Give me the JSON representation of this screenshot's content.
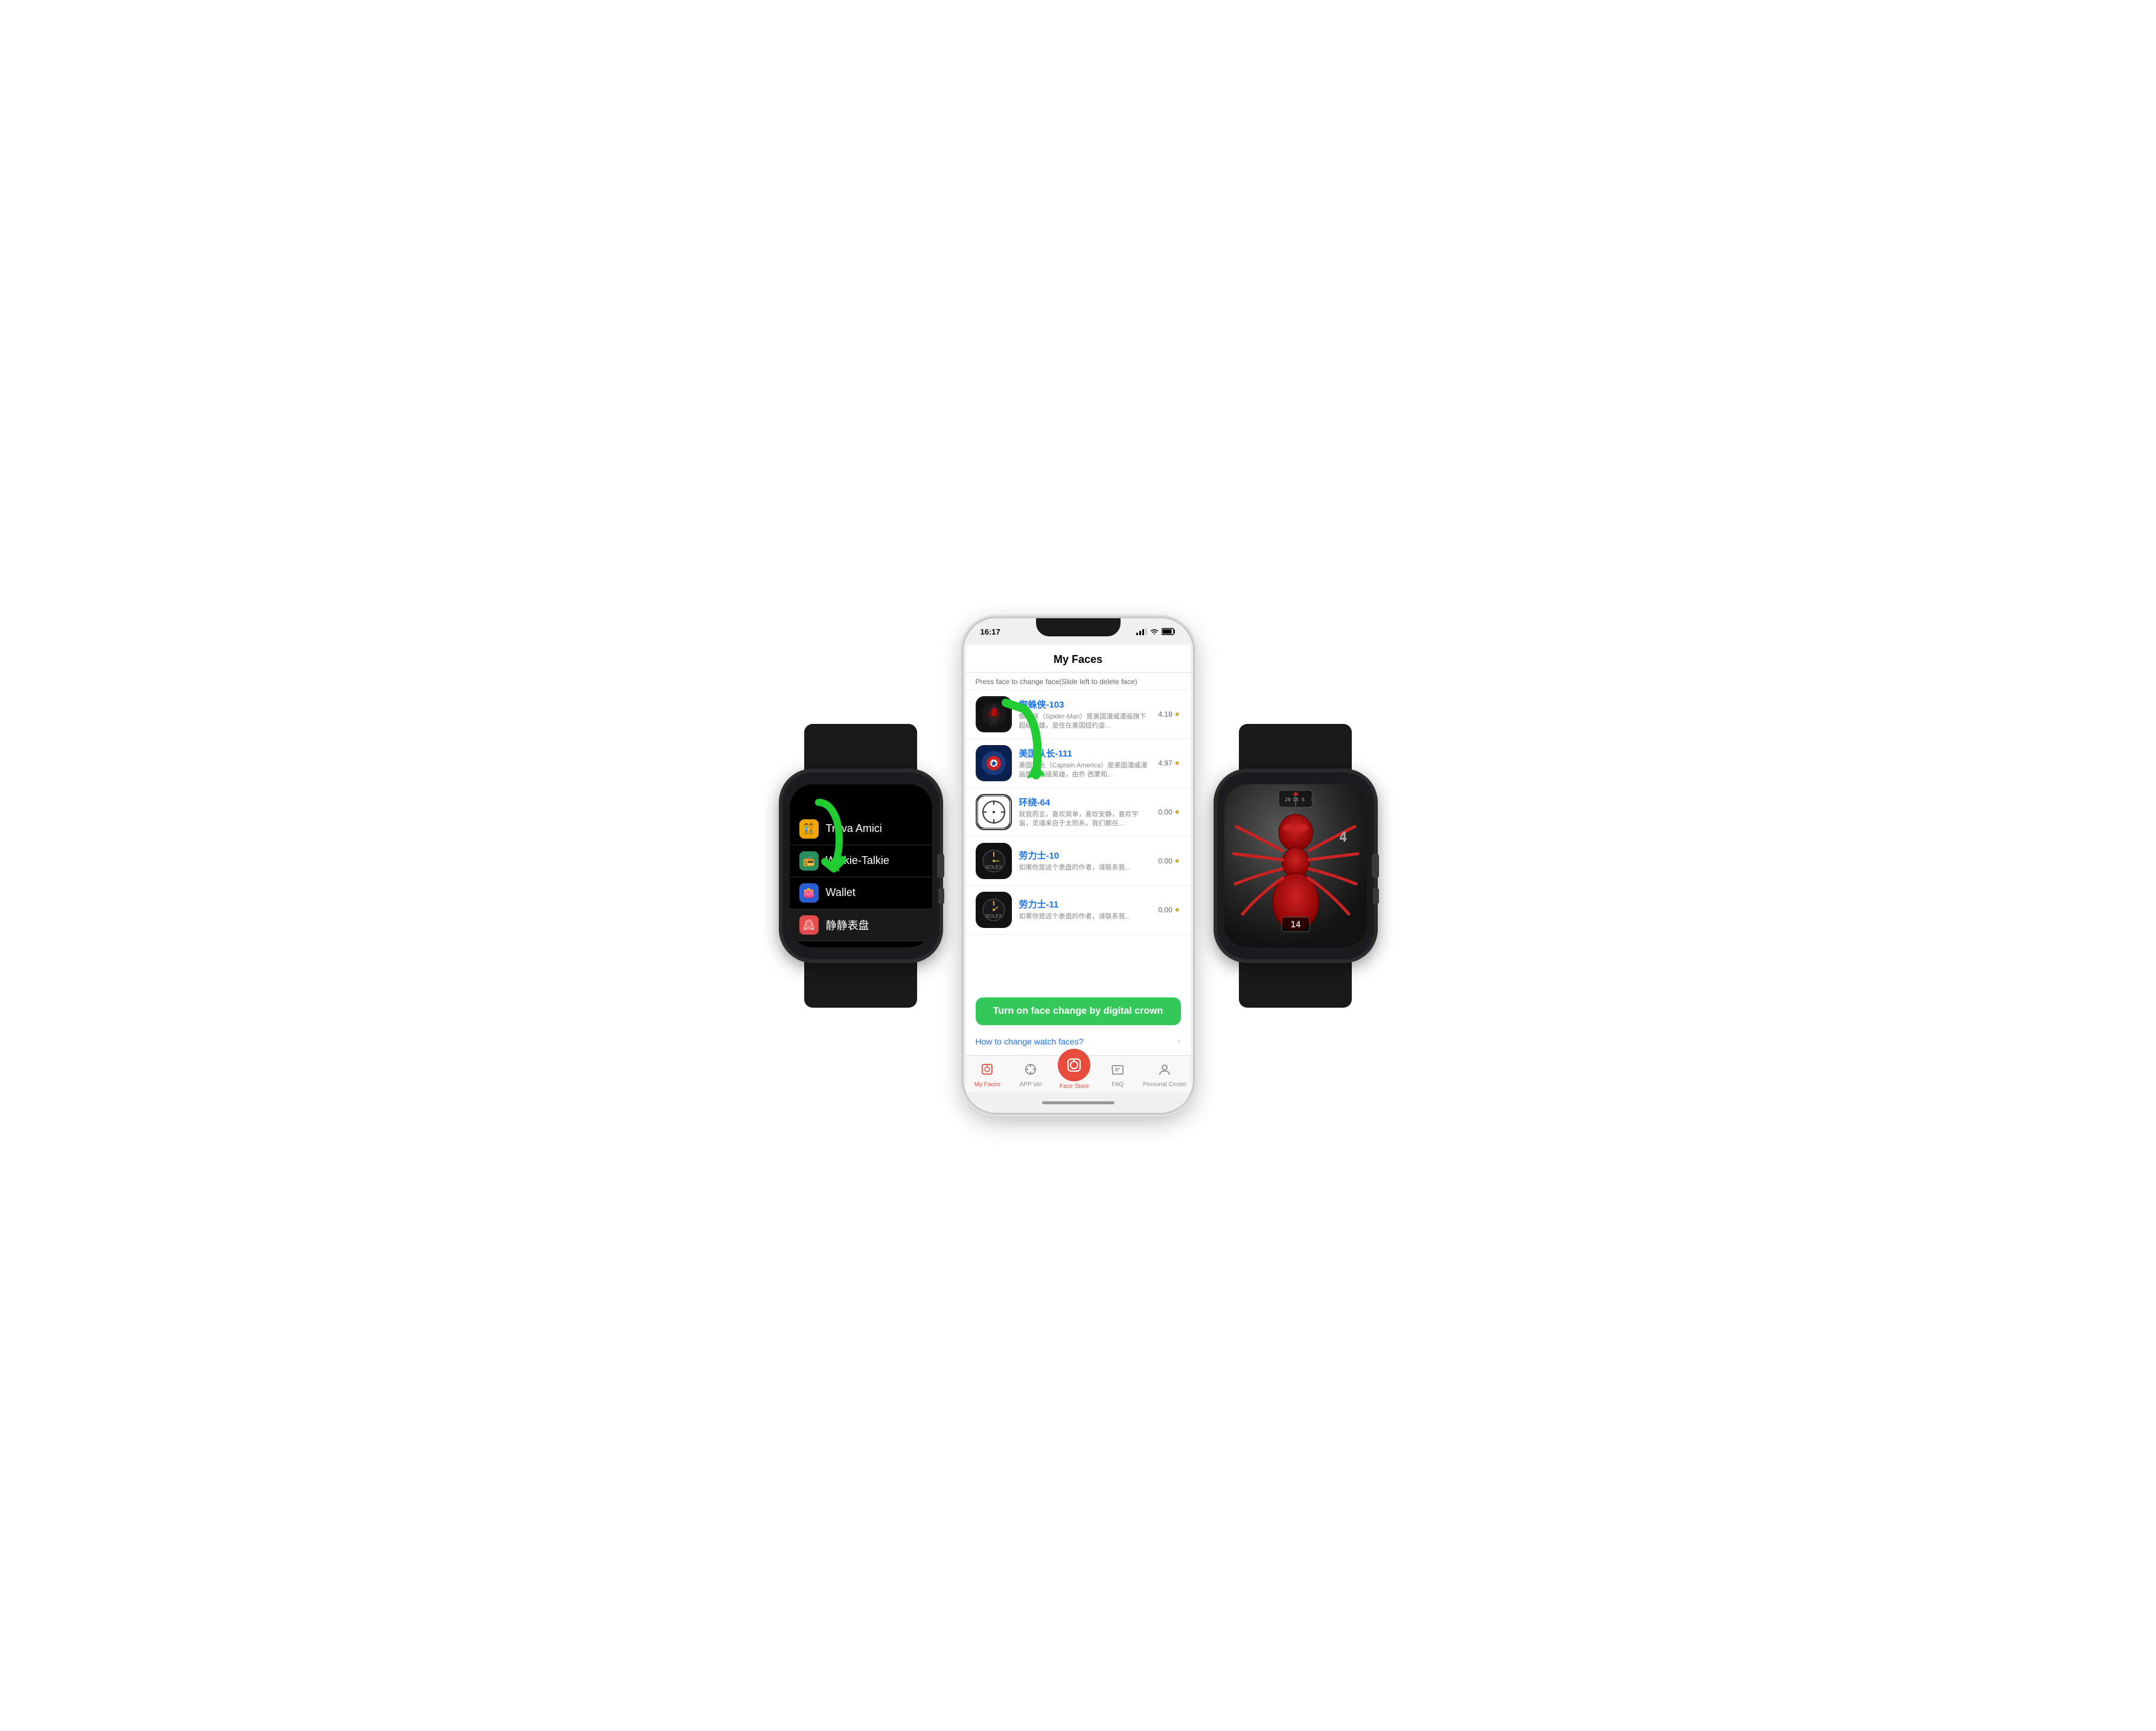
{
  "scene": {
    "bg_color": "#ffffff"
  },
  "watch_left": {
    "menu_items": [
      {
        "id": "trova",
        "icon": "🧑‍🤝‍🧑",
        "icon_bg": "#f0a500",
        "label": "Trova Amici"
      },
      {
        "id": "walkie",
        "icon": "",
        "icon_bg": "transparent",
        "label": "Walkie-Talkie"
      },
      {
        "id": "wallet",
        "icon": "",
        "icon_bg": "transparent",
        "label": "Wallet"
      },
      {
        "id": "jingji",
        "icon": "🕰",
        "icon_bg": "#e74c4c",
        "label": "静静表盘"
      }
    ]
  },
  "iphone": {
    "status_bar": {
      "time": "16:17",
      "signal": "▲▲▲",
      "wifi": "wifi",
      "battery": "battery"
    },
    "screen": {
      "title": "My Faces",
      "subtitle": "Press face to change face(Slide left to delete face)",
      "faces": [
        {
          "id": "spiderman",
          "title": "蜘蛛侠-103",
          "desc": "蜘蛛侠（Spider-Man）是美国漫威漫画旗下超级英雄，是住在美国纽约皇...",
          "rating": "4.18"
        },
        {
          "id": "captain",
          "title": "美国队长-111",
          "desc": "美国队长（Captain America）是美国漫威漫画旗下超级英雄，由乔·西蒙和...",
          "rating": "4.97"
        },
        {
          "id": "huanrao",
          "title": "环绕-64",
          "desc": "就我而言，喜欢简单，喜欢安静，喜欢宇宙，灵魂来自于太阳系，我们都在...",
          "rating": "0.00"
        },
        {
          "id": "rolex10",
          "title": "劳力士-10",
          "desc": "如果你是这个表盘的作者，请联系我...",
          "rating": "0.00"
        },
        {
          "id": "rolex11",
          "title": "劳力士-11",
          "desc": "如果你是这个表盘的作者，请联系我...",
          "rating": "0.00"
        }
      ],
      "green_btn": "Turn on face change by digital crown",
      "how_to_link": "How to change watch faces?",
      "tab_bar": {
        "tabs": [
          {
            "id": "myfaces",
            "icon": "🕐",
            "label": "My Faces",
            "active": true
          },
          {
            "id": "appver",
            "icon": "📡",
            "label": "APP Ver",
            "active": false
          },
          {
            "id": "facestore",
            "icon": "🟥",
            "label": "Face Store",
            "center": true
          },
          {
            "id": "faq",
            "icon": "💬",
            "label": "FAQ",
            "active": false
          },
          {
            "id": "personal",
            "icon": "👤",
            "label": "Personal Center",
            "active": false
          }
        ]
      }
    }
  },
  "watch_right": {
    "display": "spider_watch_face",
    "number": "14"
  }
}
